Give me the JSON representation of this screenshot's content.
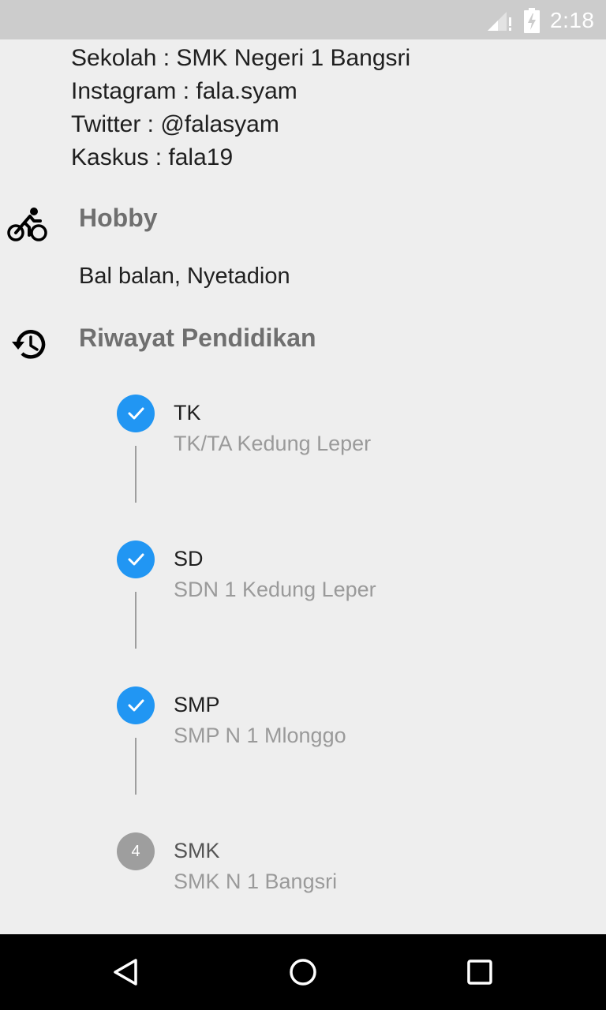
{
  "status_bar": {
    "time": "2:18",
    "icons": [
      "signal-no-data-icon",
      "battery-charging-icon"
    ]
  },
  "profile_info": [
    "Sekolah : SMK Negeri 1 Bangsri",
    "Instagram : fala.syam",
    "Twitter : @falasyam",
    "Kaskus : fala19"
  ],
  "hobby": {
    "icon": "bike-icon",
    "title": "Hobby",
    "text": "Bal balan, Nyetadion"
  },
  "education": {
    "icon": "history-icon",
    "title": "Riwayat Pendidikan",
    "steps": [
      {
        "title": "TK",
        "subtitle": "TK/TA Kedung Leper",
        "status": "done"
      },
      {
        "title": "SD",
        "subtitle": "SDN 1 Kedung Leper",
        "status": "done"
      },
      {
        "title": "SMP",
        "subtitle": "SMP N 1 Mlonggo",
        "status": "done"
      },
      {
        "title": "SMK",
        "subtitle": "SMK N 1 Bangsri",
        "status": "pending",
        "number": "4"
      }
    ]
  },
  "nav_bar": {
    "icons": [
      "back-icon",
      "home-icon",
      "recents-icon"
    ]
  },
  "colors": {
    "accent": "#2196f3",
    "pending": "#9e9e9e",
    "background": "#eeeeee",
    "status_bar": "#cccccc"
  }
}
